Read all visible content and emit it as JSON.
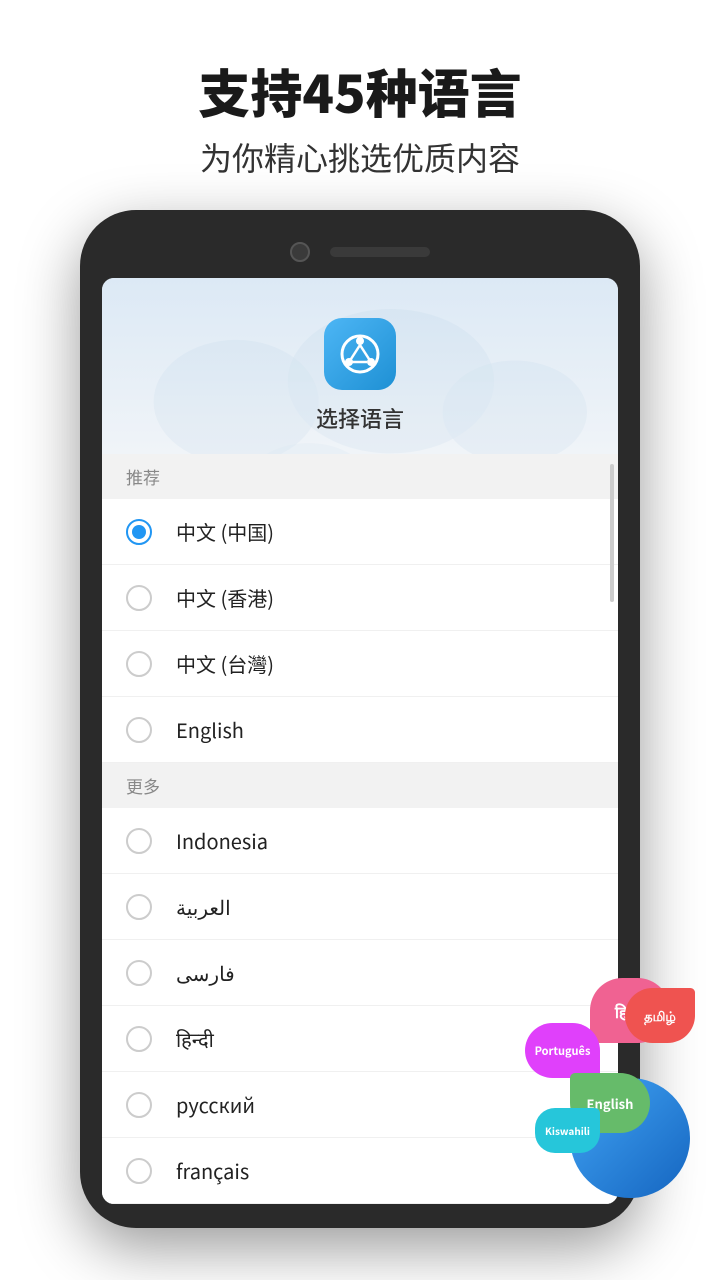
{
  "header": {
    "title": "支持45种语言",
    "subtitle": "为你精心挑选优质内容"
  },
  "phone": {
    "screen": {
      "app_icon_symbol": "↺",
      "title": "选择语言",
      "sections": [
        {
          "label": "推荐",
          "items": [
            {
              "name": "中文 (中国)",
              "selected": true
            },
            {
              "name": "中文 (香港)",
              "selected": false
            },
            {
              "name": "中文 (台灣)",
              "selected": false
            },
            {
              "name": "English",
              "selected": false
            }
          ]
        },
        {
          "label": "更多",
          "items": [
            {
              "name": "Indonesia",
              "selected": false
            },
            {
              "name": "العربية",
              "selected": false
            },
            {
              "name": "فارسی",
              "selected": false
            },
            {
              "name": "हिन्दी",
              "selected": false
            },
            {
              "name": "русский",
              "selected": false
            },
            {
              "name": "français",
              "selected": false
            }
          ]
        }
      ]
    }
  },
  "stickers": {
    "hindi": "हिन्दी",
    "portuguese": "Português",
    "tamil": "தமிழ்",
    "english": "English",
    "swahili": "Kiswahili"
  }
}
